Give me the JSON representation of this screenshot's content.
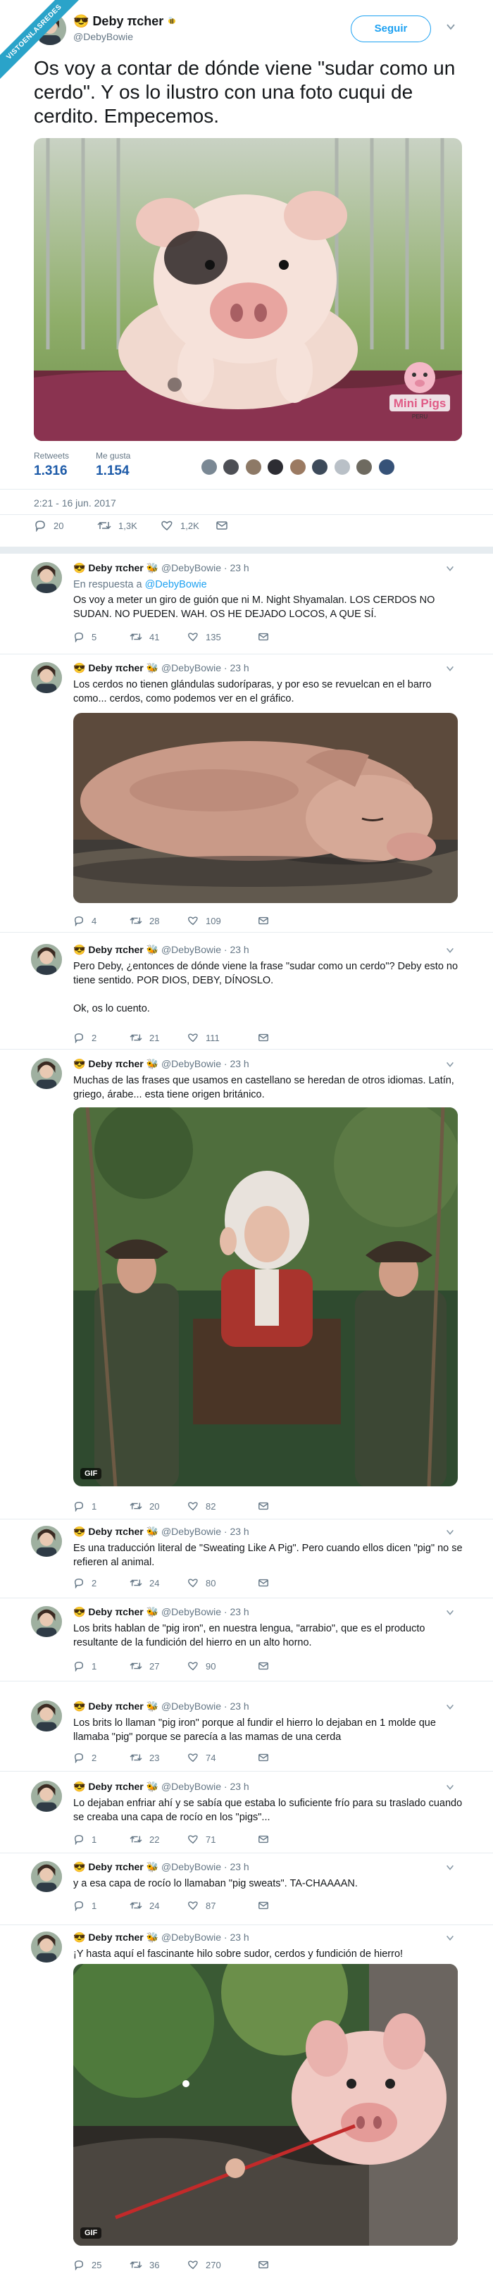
{
  "ribbon": "VISTOENLASREDES",
  "main": {
    "name": "Deby πcher",
    "name_emoji": "😎",
    "handle": "@DebyBowie",
    "follow": "Seguir",
    "text": "Os voy a contar de dónde viene \"sudar como un cerdo\". Y os lo ilustro con una foto cuqui de cerdito. Empecemos.",
    "media_watermark": "Mini Pigs",
    "media_watermark_sub": "PERU",
    "retweets_label": "Retweets",
    "retweets": "1.316",
    "likes_label": "Me gusta",
    "likes": "1.154",
    "date": "2:21 - 16 jun. 2017",
    "replies_count": "20",
    "rt_count": "1,3K",
    "like_count": "1,2K"
  },
  "replies": [
    {
      "name": "Deby πcher",
      "handle": "@DebyBowie",
      "time": "23 h",
      "in_reply_label": "En respuesta a",
      "in_reply_to": "@DebyBowie",
      "text": "Os voy a meter un giro de guión que ni M. Night Shyamalan. LOS CERDOS NO SUDAN. NO PUEDEN. WAH. OS HE DEJADO LOCOS, A QUE SÍ.",
      "replies": "5",
      "rts": "41",
      "likes": "135"
    },
    {
      "name": "Deby πcher",
      "handle": "@DebyBowie",
      "time": "23 h",
      "text": "Los cerdos no tienen glándulas sudoríparas, y por eso se revuelcan en el barro como... cerdos, como podemos ver en el gráfico.",
      "replies": "4",
      "rts": "28",
      "likes": "109"
    },
    {
      "name": "Deby πcher",
      "handle": "@DebyBowie",
      "time": "23 h",
      "text": "Pero Deby, ¿entonces de dónde viene la frase \"sudar como un cerdo\"? Deby esto no tiene sentido. POR DIOS, DEBY, DÍNOSLO.",
      "text2": "Ok, os lo cuento.",
      "replies": "2",
      "rts": "21",
      "likes": "111"
    },
    {
      "name": "Deby πcher",
      "handle": "@DebyBowie",
      "time": "23 h",
      "text": "Muchas de las frases que usamos en castellano se heredan de otros idiomas. Latín, griego, árabe... esta tiene origen británico.",
      "gif": "GIF",
      "replies": "1",
      "rts": "20",
      "likes": "82"
    },
    {
      "name": "Deby πcher",
      "handle": "@DebyBowie",
      "time": "23 h",
      "text": "Es una traducción literal de \"Sweating Like A Pig\". Pero cuando ellos dicen \"pig\" no se refieren al animal.",
      "replies": "2",
      "rts": "24",
      "likes": "80"
    },
    {
      "name": "Deby πcher",
      "handle": "@DebyBowie",
      "time": "23 h",
      "text": "Los brits hablan de \"pig iron\", en nuestra lengua, \"arrabio\", que es el producto resultante de la fundición del hierro en un alto horno.",
      "replies": "1",
      "rts": "27",
      "likes": "90"
    },
    {
      "name": "Deby πcher",
      "handle": "@DebyBowie",
      "time": "23 h",
      "text": "Los brits lo llaman \"pig iron\" porque al fundir el hierro lo dejaban en 1 molde que llamaba \"pig\" porque se parecía a las mamas de una cerda",
      "replies": "2",
      "rts": "23",
      "likes": "74"
    },
    {
      "name": "Deby πcher",
      "handle": "@DebyBowie",
      "time": "23 h",
      "text": "Lo dejaban enfriar ahí y se sabía que estaba lo suficiente frío para su traslado cuando se creaba una capa de rocío en los \"pigs\"...",
      "replies": "1",
      "rts": "22",
      "likes": "71"
    },
    {
      "name": "Deby πcher",
      "handle": "@DebyBowie",
      "time": "23 h",
      "text": "y a esa capa de rocío lo llamaban \"pig sweats\". TA-CHAAAAN.",
      "replies": "1",
      "rts": "24",
      "likes": "87"
    },
    {
      "name": "Deby πcher",
      "handle": "@DebyBowie",
      "time": "23 h",
      "text": "¡Y hasta aquí el fascinante hilo sobre sudor, cerdos y fundición de hierro!",
      "gif": "GIF",
      "replies": "25",
      "rts": "36",
      "likes": "270"
    }
  ],
  "colors": {
    "accent": "#1da1f2",
    "stat_num": "#1c5aa8",
    "meta": "#657786",
    "separator": "#e6ecf0"
  }
}
